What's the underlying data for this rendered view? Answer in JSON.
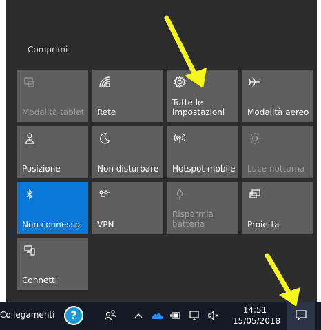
{
  "action_center": {
    "collapse_label": "Comprimi",
    "tiles": [
      {
        "label": "Modalità tablet",
        "state": "disabled",
        "icon": "tablet-mode-icon"
      },
      {
        "label": "Rete",
        "state": "off",
        "icon": "network-icon"
      },
      {
        "label": "Tutte le\nimpostazioni",
        "state": "off",
        "icon": "gear-icon"
      },
      {
        "label": "Modalità aereo",
        "state": "off",
        "icon": "airplane-icon"
      },
      {
        "label": "Posizione",
        "state": "off",
        "icon": "location-icon"
      },
      {
        "label": "Non disturbare",
        "state": "off",
        "icon": "moon-icon"
      },
      {
        "label": "Hotspot mobile",
        "state": "off",
        "icon": "hotspot-icon"
      },
      {
        "label": "Luce notturna",
        "state": "disabled",
        "icon": "brightness-icon"
      },
      {
        "label": "Non connesso",
        "state": "on",
        "icon": "bluetooth-icon"
      },
      {
        "label": "VPN",
        "state": "off",
        "icon": "vpn-icon"
      },
      {
        "label": "Risparmia\nbatteria",
        "state": "disabled",
        "icon": "battery-saver-icon"
      },
      {
        "label": "Proietta",
        "state": "off",
        "icon": "project-icon"
      },
      {
        "label": "Connetti",
        "state": "off",
        "icon": "connect-icon"
      }
    ]
  },
  "taskbar": {
    "links_label": "Collegamenti",
    "help_glyph": "?",
    "clock_time": "14:51",
    "clock_date": "15/05/2018",
    "icons": [
      "people-icon",
      "chevron-up-icon",
      "onedrive-icon",
      "battery-icon",
      "network-icon",
      "volume-muted-icon"
    ],
    "notification_icon": "notification-icon"
  },
  "colors": {
    "panel_bg": "#2c2c2c",
    "tile_off": "#5e5e5e",
    "tile_on": "#0a78d7",
    "taskbar_bg": "#141b27",
    "annotation_arrow": "#f5f51c"
  }
}
